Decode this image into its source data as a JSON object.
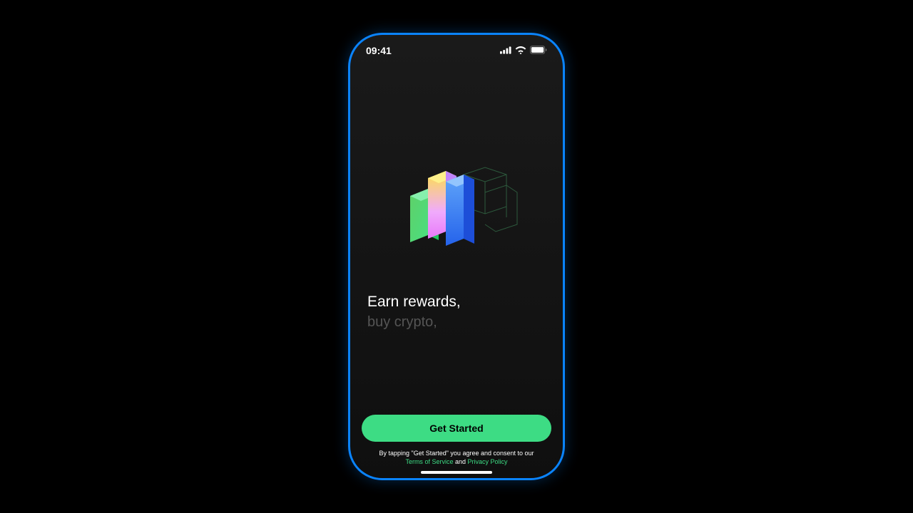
{
  "statusBar": {
    "time": "09:41"
  },
  "hero": {
    "headlinePrimary": "Earn rewards,",
    "headlineSecondary": "buy crypto,"
  },
  "cta": {
    "label": "Get Started"
  },
  "consent": {
    "prefix": "By tapping \"Get Started\" you agree and consent to our",
    "termsLabel": "Terms of Service",
    "and": "and",
    "privacyLabel": "Privacy Policy"
  }
}
